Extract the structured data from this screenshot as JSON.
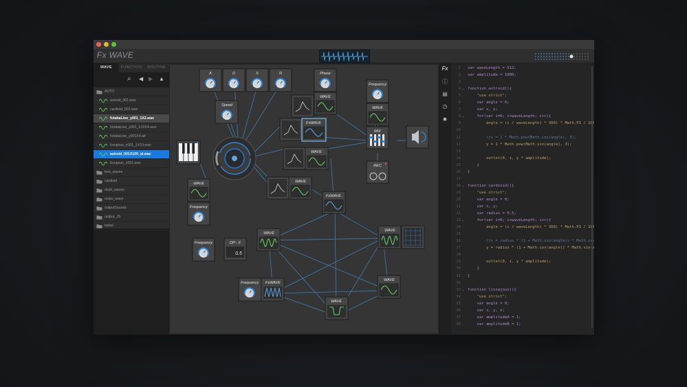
{
  "app": {
    "title": "Fx WAVE"
  },
  "sidebar": {
    "tabs": [
      {
        "label": "WAVE",
        "active": true
      },
      {
        "label": "FUNCTION",
        "active": false
      },
      {
        "label": "ROUTINE",
        "active": false
      }
    ],
    "tools": [
      "search-icon",
      "play-back-icon",
      "play-forward-icon",
      "eject-icon"
    ],
    "files": [
      {
        "label": "AUTO",
        "type": "folder",
        "state": "open"
      },
      {
        "label": "astroid_001.wav",
        "type": "wave"
      },
      {
        "label": "cardioid_001.wav",
        "type": "wave"
      },
      {
        "label": "futabaLine_y001_1X2.wav",
        "type": "wave",
        "state": "selected"
      },
      {
        "label": "futabaLine_y001_1X2X4.wav",
        "type": "wave"
      },
      {
        "label": "futabaLine_y001X4.aif",
        "type": "wave"
      },
      {
        "label": "lissajous_z001_1X10.wav",
        "type": "wave"
      },
      {
        "label": "astroid_001X100_al.wav",
        "type": "wave",
        "state": "highlighted"
      },
      {
        "label": "lissajous_z001.wav",
        "type": "wave"
      },
      {
        "label": "boo_waves",
        "type": "folder"
      },
      {
        "label": "cardioid",
        "type": "folder"
      },
      {
        "label": "multi_waves",
        "type": "folder"
      },
      {
        "label": "noise_wave",
        "type": "folder"
      },
      {
        "label": "outputSounds",
        "type": "folder"
      },
      {
        "label": "output_JS",
        "type": "folder"
      },
      {
        "label": "trefoil",
        "type": "folder"
      }
    ]
  },
  "canvas": {
    "adsr": [
      "A",
      "D",
      "S",
      "R"
    ],
    "labels": {
      "phase": "Phase",
      "speed": "Speed",
      "frequency": "Frequency",
      "wave": "WAVE",
      "fxwave": "FxWAVE",
      "mix": "MIX",
      "rec": "REC",
      "dpx": "DP - X",
      "dpx_value": "0.5"
    }
  },
  "editor": {
    "fx_label": "Fx",
    "gutter_icons": [
      "info-icon",
      "panel-icon",
      "clock-icon",
      "bug-icon"
    ],
    "lines": [
      {
        "n": "1",
        "t": "var waveLength = 512;"
      },
      {
        "n": "2",
        "t": "var amplitude = 1000;"
      },
      {
        "n": "3",
        "t": ""
      },
      {
        "n": "4",
        "t": "function astroid(){",
        "fold": true
      },
      {
        "n": "5",
        "t": "    \"use strict\";"
      },
      {
        "n": "6",
        "t": "    var angle = 0;"
      },
      {
        "n": "7",
        "t": "    var x, y;"
      },
      {
        "n": "8",
        "t": "    for(var i=0; i<waveLength; i++){",
        "fold": true
      },
      {
        "n": "9",
        "t": "        angle = (i / waveLength) * 360) * Math.PI / 180;"
      },
      {
        "n": "10",
        "t": ""
      },
      {
        "n": "11",
        "t": "        //x = 1 * Math.pow(Math.cos(angle), 3);",
        "comment": true
      },
      {
        "n": "12",
        "t": "        y = 1 * Math.pow(Math.sin(angle), 3);"
      },
      {
        "n": "13",
        "t": ""
      },
      {
        "n": "14",
        "t": "        outlet(0, i, y * amplitude);"
      },
      {
        "n": "15",
        "t": "    }"
      },
      {
        "n": "16",
        "t": "}"
      },
      {
        "n": "17",
        "t": ""
      },
      {
        "n": "18",
        "t": "function cardioid(){",
        "fold": true
      },
      {
        "n": "19",
        "t": "    \"use strict\";"
      },
      {
        "n": "20",
        "t": "    var angle = 0;"
      },
      {
        "n": "21",
        "t": "    var x, y;"
      },
      {
        "n": "22",
        "t": "    var radius = 0.5;"
      },
      {
        "n": "23",
        "t": "    for(var i=0; i<waveLength; i++){",
        "fold": true
      },
      {
        "n": "24",
        "t": "        angle = (i / waveLength) * 360) * Math.PI / 180;"
      },
      {
        "n": "25",
        "t": ""
      },
      {
        "n": "26",
        "t": "        //x = radius * (1 + Math.cos(angle)) * Math.cos(angle);",
        "comment": true
      },
      {
        "n": "27",
        "t": "        y = radius * (1 + Math.cos(angle)) * Math.sin(angle);"
      },
      {
        "n": "28",
        "t": ""
      },
      {
        "n": "29",
        "t": "        outlet(0, i, y * amplitude);"
      },
      {
        "n": "30",
        "t": "    }"
      },
      {
        "n": "31",
        "t": "}"
      },
      {
        "n": "32",
        "t": ""
      },
      {
        "n": "33",
        "t": "function lissajous(){",
        "fold": true
      },
      {
        "n": "34",
        "t": "    \"use strict\";"
      },
      {
        "n": "35",
        "t": "    var angle = 0;"
      },
      {
        "n": "36",
        "t": "    var x, y, z;"
      },
      {
        "n": "37",
        "t": "    var amplitudeA = 1;"
      },
      {
        "n": "38",
        "t": "    var amplitudeB = 1;"
      }
    ]
  },
  "colors": {
    "accent_blue": "#1a7ae0",
    "wave_green": "#5fd05f",
    "wire_blue": "#3d8fd6",
    "code_string": "#c2a06a",
    "code_keyword": "#b48ad6"
  }
}
